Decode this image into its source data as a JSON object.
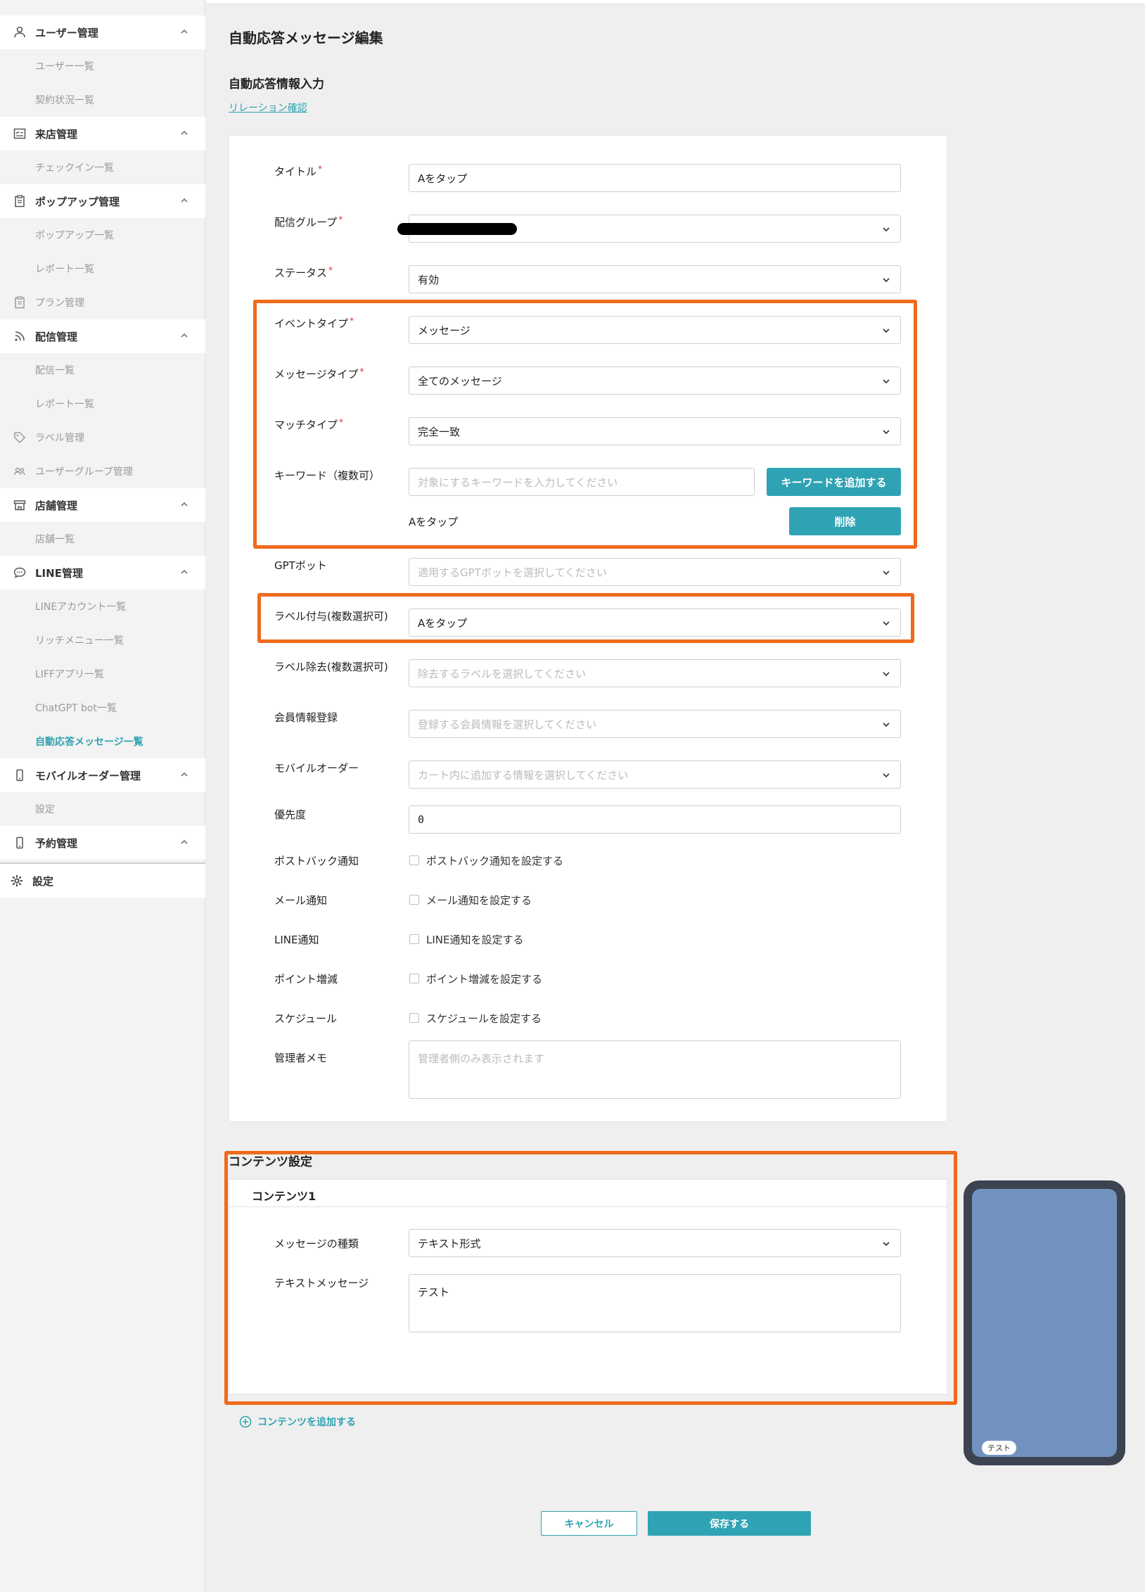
{
  "sidebar": {
    "user_mgmt": "ユーザー管理",
    "user_list": "ユーザー一覧",
    "contract_list": "契約状況一覧",
    "visit_mgmt": "来店管理",
    "checkin_list": "チェックイン一覧",
    "popup_mgmt": "ポップアップ管理",
    "popup_list": "ポップアップ一覧",
    "popup_report": "レポート一覧",
    "plan_mgmt": "プラン管理",
    "delivery_mgmt": "配信管理",
    "delivery_list": "配信一覧",
    "delivery_report": "レポート一覧",
    "label_mgmt": "ラベル管理",
    "usergroup_mgmt": "ユーザーグループ管理",
    "store_mgmt": "店舗管理",
    "store_list": "店舗一覧",
    "line_mgmt": "LINE管理",
    "line_account_list": "LINEアカウント一覧",
    "rich_menu_list": "リッチメニュー一覧",
    "liff_list": "LIFFアプリ一覧",
    "chatgpt_list": "ChatGPT bot一覧",
    "auto_reply_list": "自動応答メッセージ一覧",
    "mobile_order_mgmt": "モバイルオーダー管理",
    "mobile_order_settings": "設定",
    "reservation_mgmt": "予約管理",
    "settings": "設定"
  },
  "main": {
    "page_title": "自動応答メッセージ編集",
    "section_title": "自動応答情報入力",
    "relation_link": "リレーション確認"
  },
  "form": {
    "title_label": "タイトル",
    "title_value": "Aをタップ",
    "group_label": "配信グループ",
    "status_label": "ステータス",
    "status_value": "有効",
    "event_type_label": "イベントタイプ",
    "event_type_value": "メッセージ",
    "message_type_label": "メッセージタイプ",
    "message_type_value": "全てのメッセージ",
    "match_type_label": "マッチタイプ",
    "match_type_value": "完全一致",
    "keyword_label": "キーワード（複数可）",
    "keyword_placeholder": "対象にするキーワードを入力してください",
    "keyword_add_button": "キーワードを追加する",
    "keyword_item": "Aをタップ",
    "keyword_delete_button": "削除",
    "gpt_bot_label": "GPTボット",
    "gpt_bot_placeholder": "適用するGPTボットを選択してください",
    "label_add_label": "ラベル付与(複数選択可)",
    "label_add_value": "Aをタップ",
    "label_remove_label": "ラベル除去(複数選択可)",
    "label_remove_placeholder": "除去するラベルを選択してください",
    "member_info_label": "会員情報登録",
    "member_info_placeholder": "登録する会員情報を選択してください",
    "mobile_order_label": "モバイルオーダー",
    "mobile_order_placeholder": "カート内に追加する情報を選択してください",
    "priority_label": "優先度",
    "priority_value": "0",
    "postback_label": "ポストバック通知",
    "postback_check": "ポストバック通知を設定する",
    "mail_label": "メール通知",
    "mail_check": "メール通知を設定する",
    "line_label": "LINE通知",
    "line_check": "LINE通知を設定する",
    "point_label": "ポイント増減",
    "point_check": "ポイント増減を設定する",
    "schedule_label": "スケジュール",
    "schedule_check": "スケジュールを設定する",
    "memo_label": "管理者メモ",
    "memo_placeholder": "管理者側のみ表示されます"
  },
  "content": {
    "section_title": "コンテンツ設定",
    "card_title": "コンテンツ1",
    "msg_kind_label": "メッセージの種類",
    "msg_kind_value": "テキスト形式",
    "text_msg_label": "テキストメッセージ",
    "text_msg_value": "テスト",
    "add_content": "コンテンツを追加する"
  },
  "preview": {
    "bubble_text": "テスト"
  },
  "footer": {
    "cancel": "キャンセル",
    "save": "保存する"
  },
  "colors": {
    "accent": "#2fa3b3",
    "highlight": "#f06a1c",
    "preview_bg": "#7293c0"
  }
}
